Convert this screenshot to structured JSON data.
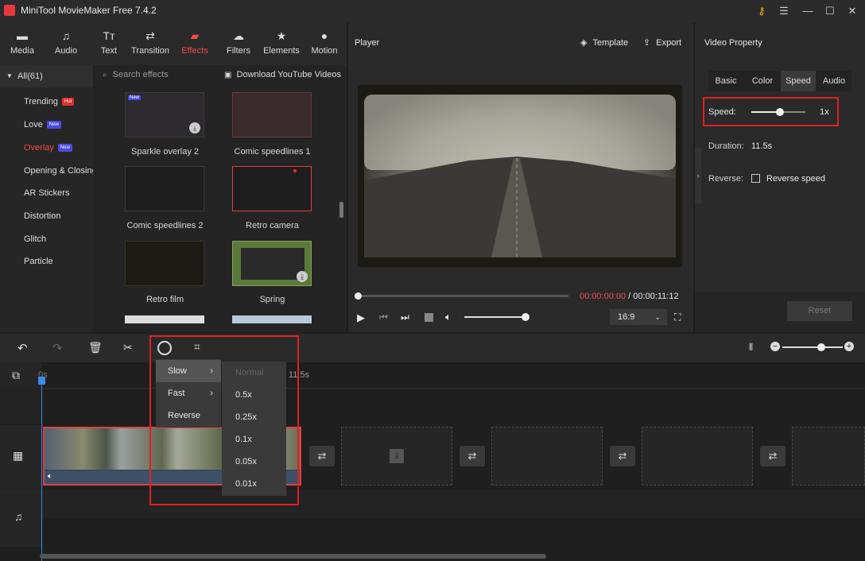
{
  "app": {
    "title": "MiniTool MovieMaker Free 7.4.2"
  },
  "toolbar": {
    "tabs": [
      {
        "label": "Media",
        "icon": "folder-icon"
      },
      {
        "label": "Audio",
        "icon": "music-note-icon"
      },
      {
        "label": "Text",
        "icon": "text-icon"
      },
      {
        "label": "Transition",
        "icon": "transition-icon"
      },
      {
        "label": "Effects",
        "icon": "effects-icon"
      },
      {
        "label": "Filters",
        "icon": "filters-icon"
      },
      {
        "label": "Elements",
        "icon": "elements-icon"
      },
      {
        "label": "Motion",
        "icon": "motion-icon"
      }
    ],
    "active": "Effects"
  },
  "categories": {
    "all": "All(61)",
    "items": [
      {
        "label": "Trending",
        "badge": "Hot"
      },
      {
        "label": "Love",
        "badge": "New"
      },
      {
        "label": "Overlay",
        "badge": "New"
      },
      {
        "label": "Opening & Closing",
        "badge": ""
      },
      {
        "label": "AR Stickers",
        "badge": ""
      },
      {
        "label": "Distortion",
        "badge": ""
      },
      {
        "label": "Glitch",
        "badge": ""
      },
      {
        "label": "Particle",
        "badge": ""
      }
    ]
  },
  "effects": {
    "search_placeholder": "Search effects",
    "download_link": "Download YouTube Videos",
    "items": [
      "Sparkle overlay 2",
      "Comic speedlines 1",
      "Comic speedlines 2",
      "Retro camera",
      "Retro film",
      "Spring"
    ],
    "new_badge": "New"
  },
  "player": {
    "title": "Player",
    "template": "Template",
    "export": "Export",
    "current_time": "00:00:00:00",
    "separator": " / ",
    "total_time": "00:00:11:12",
    "aspect": "16:9"
  },
  "props": {
    "title": "Video Property",
    "tabs": [
      "Basic",
      "Color",
      "Speed",
      "Audio"
    ],
    "active_tab": "Speed",
    "speed_label": "Speed:",
    "speed_value": "1x",
    "duration_label": "Duration:",
    "duration_value": "11.5s",
    "reverse_label": "Reverse:",
    "reverse_checkbox": "Reverse speed",
    "reset": "Reset"
  },
  "timeline": {
    "ruler_start": "0s",
    "ruler_mark": "11.5s"
  },
  "speed_menu": {
    "items": [
      "Slow",
      "Fast",
      "Reverse"
    ],
    "submenu": [
      "Normal",
      "0.5x",
      "0.25x",
      "0.1x",
      "0.05x",
      "0.01x"
    ]
  },
  "colors": {
    "accent": "#f04848",
    "highlight_box": "#e02020"
  }
}
